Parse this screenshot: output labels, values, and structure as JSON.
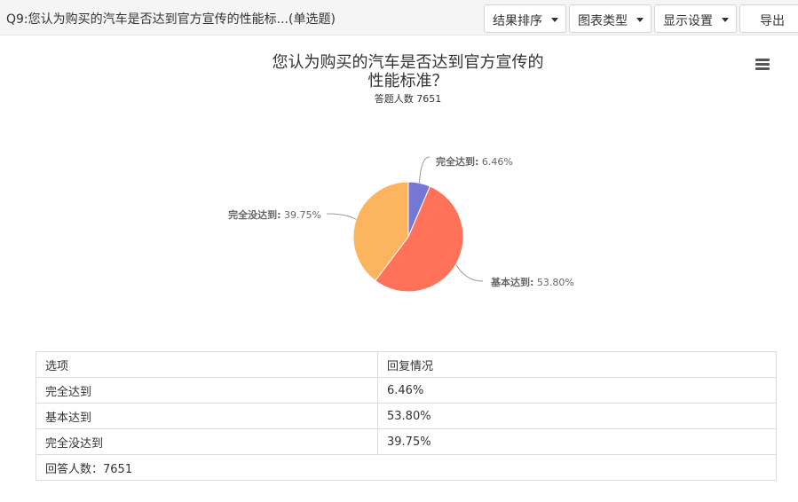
{
  "header": {
    "question_title": "Q9:您认为购买的汽车是否达到官方宣传的性能标...(单选题)",
    "buttons": [
      {
        "label": "结果排序"
      },
      {
        "label": "图表类型"
      },
      {
        "label": "显示设置"
      },
      {
        "label": "导出"
      }
    ]
  },
  "chart_data": {
    "type": "pie",
    "title_line1": "您认为购买的汽车是否达到官方宣传的",
    "title_line2": "性能标准？",
    "subtitle": "答题人数 7651",
    "slices": [
      {
        "label": "完全达到",
        "value": 6.46,
        "display": "6.46%",
        "color": "#7477d4"
      },
      {
        "label": "基本达到",
        "value": 53.8,
        "display": "53.80%",
        "color": "#ff7158"
      },
      {
        "label": "完全没达到",
        "value": 39.75,
        "display": "39.75%",
        "color": "#fdb45e"
      }
    ]
  },
  "table": {
    "headers": [
      "选项",
      "回复情况"
    ],
    "rows": [
      [
        "完全达到",
        "6.46%"
      ],
      [
        "基本达到",
        "53.80%"
      ],
      [
        "完全没达到",
        "39.75%"
      ]
    ],
    "footer": "回答人数：7651"
  }
}
